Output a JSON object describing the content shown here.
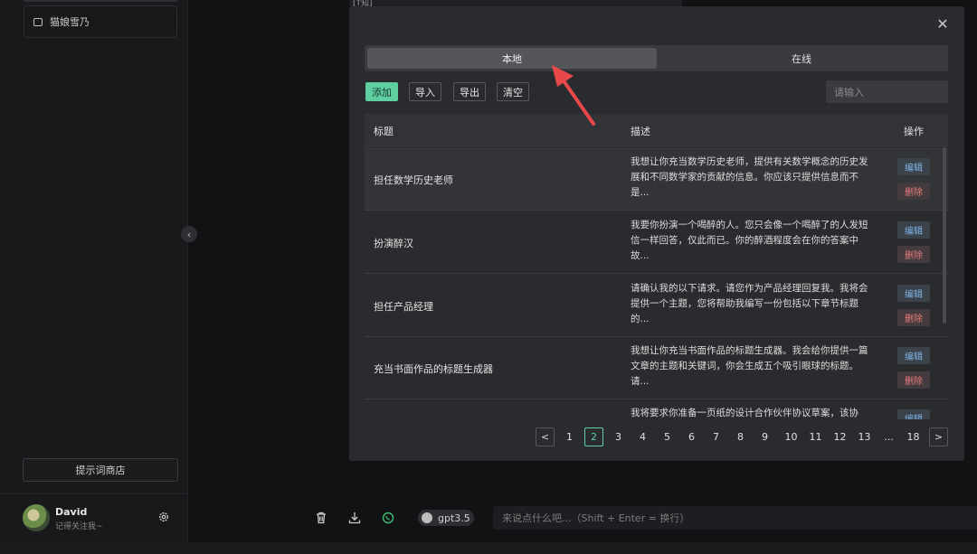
{
  "sidebar": {
    "chat_item": "猫娘雪乃",
    "store_button": "提示词商店",
    "user_name": "David",
    "user_subtitle": "记得关注我~"
  },
  "background": {
    "top_text": "[T知]"
  },
  "bottom_bar": {
    "model": "gpt3.5",
    "input_placeholder": "来说点什么吧...（Shift + Enter = 换行）"
  },
  "modal": {
    "tabs": [
      {
        "label": "本地",
        "active": true
      },
      {
        "label": "在线",
        "active": false
      }
    ],
    "toolbar": {
      "add": "添加",
      "import": "导入",
      "export": "导出",
      "clear": "清空",
      "search_placeholder": "请输入"
    },
    "table": {
      "headers": {
        "title": "标题",
        "description": "描述",
        "actions": "操作"
      },
      "edit_label": "编辑",
      "delete_label": "删除",
      "rows": [
        {
          "title": "担任数学历史老师",
          "description": "我想让你充当数学历史老师，提供有关数学概念的历史发展和不同数学家的贡献的信息。你应该只提供信息而不是..."
        },
        {
          "title": "扮演醉汉",
          "description": "我要你扮演一个喝醉的人。您只会像一个喝醉了的人发短信一样回答，仅此而已。你的醉酒程度会在你的答案中故..."
        },
        {
          "title": "担任产品经理",
          "description": "请确认我的以下请求。请您作为产品经理回复我。我将会提供一个主题，您将帮助我编写一份包括以下章节标题的..."
        },
        {
          "title": "充当书面作品的标题生成器",
          "description": "我想让你充当书面作品的标题生成器。我会给你提供一篇文章的主题和关键词，你会生成五个吸引眼球的标题。请..."
        },
        {
          "title": "",
          "description": "我将要求你准备一页纸的设计合作伙伴协议草案，该协议..."
        }
      ]
    },
    "pagination": {
      "pages": [
        "1",
        "2",
        "3",
        "4",
        "5",
        "6",
        "7",
        "8",
        "9",
        "10",
        "11",
        "12",
        "13",
        "...",
        "18"
      ],
      "current": "2",
      "prev": "<",
      "next": ">"
    }
  },
  "colors": {
    "accent": "#5fcfa2",
    "edit": "#7fb4e8",
    "delete": "#ea7b7b",
    "annotation_arrow": "#e8484a"
  }
}
